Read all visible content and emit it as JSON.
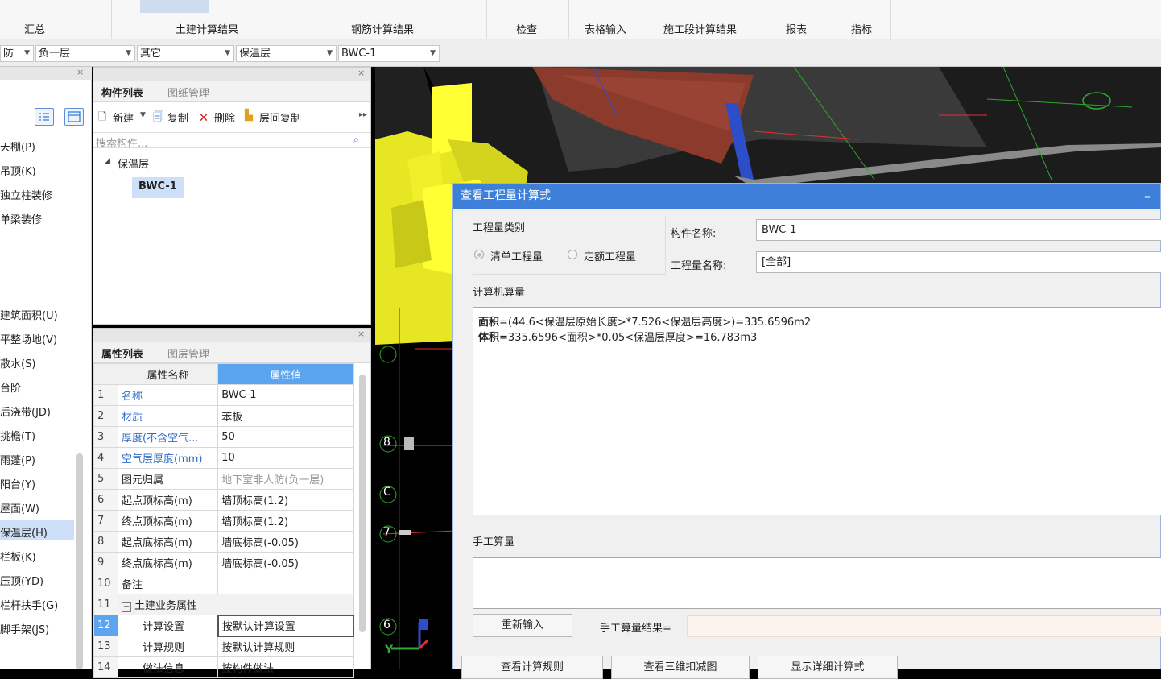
{
  "ribbon": {
    "tabs": [
      "汇总",
      "土建计算结果",
      "钢筋计算结果",
      "检查",
      "表格输入",
      "施工段计算结果",
      "报表",
      "指标"
    ]
  },
  "filters": {
    "floor_type": "防",
    "floor": "负一层",
    "category": "其它",
    "component_type": "保温层",
    "component": "BWC-1"
  },
  "left_panel": {
    "items_top": [
      "天棚(P)",
      "吊顶(K)",
      "独立柱装修",
      "单梁装修"
    ],
    "items_bottom": [
      "建筑面积(U)",
      "平整场地(V)",
      "散水(S)",
      "台阶",
      "后浇带(JD)",
      "挑檐(T)",
      "雨蓬(P)",
      "阳台(Y)",
      "屋面(W)",
      "保温层(H)",
      "栏板(K)",
      "压顶(YD)",
      "栏杆扶手(G)",
      "脚手架(JS)"
    ],
    "selected": "保温层(H)"
  },
  "component_panel": {
    "tab_active": "构件列表",
    "tab_inactive": "图纸管理",
    "toolbar": {
      "new": "新建",
      "copy": "复制",
      "delete": "删除",
      "layer_copy": "层间复制"
    },
    "search_placeholder": "搜索构件...",
    "tree_group": "保温层",
    "tree_item": "BWC-1"
  },
  "property_panel": {
    "tab_active": "属性列表",
    "tab_inactive": "图层管理",
    "col_name": "属性名称",
    "col_value": "属性值",
    "rows": [
      {
        "idx": "1",
        "name": "名称",
        "value": "BWC-1"
      },
      {
        "idx": "2",
        "name": "材质",
        "value": "苯板"
      },
      {
        "idx": "3",
        "name": "厚度(不含空气...",
        "value": "50"
      },
      {
        "idx": "4",
        "name": "空气层厚度(mm)",
        "value": "10"
      },
      {
        "idx": "5",
        "name": "图元归属",
        "value": "地下室非人防(负一层)"
      },
      {
        "idx": "6",
        "name": "起点顶标高(m)",
        "value": "墙顶标高(1.2)"
      },
      {
        "idx": "7",
        "name": "终点顶标高(m)",
        "value": "墙顶标高(1.2)"
      },
      {
        "idx": "8",
        "name": "起点底标高(m)",
        "value": "墙底标高(-0.05)"
      },
      {
        "idx": "9",
        "name": "终点底标高(m)",
        "value": "墙底标高(-0.05)"
      },
      {
        "idx": "10",
        "name": "备注",
        "value": ""
      },
      {
        "idx": "11",
        "name": "土建业务属性",
        "value": ""
      },
      {
        "idx": "12",
        "name": "计算设置",
        "value": "按默认计算设置"
      },
      {
        "idx": "13",
        "name": "计算规则",
        "value": "按默认计算规则"
      },
      {
        "idx": "14",
        "name": "做法信息",
        "value": "按构件做法"
      }
    ]
  },
  "canvas": {
    "axis_labels": [
      "8",
      "C",
      "7",
      "6"
    ],
    "axis_y": "Y"
  },
  "dialog": {
    "title": "查看工程量计算式",
    "quantity_type_label": "工程量类别",
    "radio_list": "清单工程量",
    "radio_quota": "定额工程量",
    "component_name_label": "构件名称:",
    "component_name_value": "BWC-1",
    "quantity_name_label": "工程量名称:",
    "quantity_name_value": "[全部]",
    "computer_label": "计算机算量",
    "formula_line1_key": "面积",
    "formula_line1_rest": "=(44.6<保温层原始长度>*7.526<保温层高度>)=335.6596m2",
    "formula_line2_key": "体积",
    "formula_line2_rest": "=335.6596<面积>*0.05<保温层厚度>=16.783m3",
    "manual_label": "手工算量",
    "reinput_button": "重新输入",
    "manual_result_label": "手工算量结果=",
    "btn_rules": "查看计算规则",
    "btn_3d": "查看三维扣减图",
    "btn_detail": "显示详细计算式"
  }
}
